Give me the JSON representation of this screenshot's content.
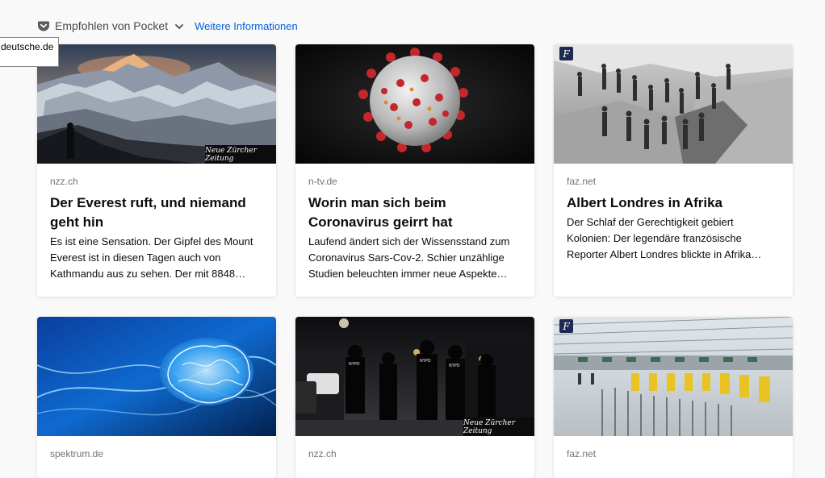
{
  "section": {
    "title": "Empfohlen von Pocket",
    "learn_more": "Weitere Informationen",
    "icon": "pocket-icon",
    "toggle_icon": "chevron-down-icon"
  },
  "tooltip": {
    "text": "deutsche.de"
  },
  "cards": [
    {
      "source": "nzz.ch",
      "title": "Der Everest ruft, und niemand geht hin",
      "excerpt": "Es ist eine Sensation. Der Gipfel des Mount Everest ist in diesen Tagen auch von Kathmandu aus zu sehen. Der mit 8848…",
      "image": "mountain-everest-image",
      "publisher_logo": "Neue Zürcher Zeitung"
    },
    {
      "source": "n-tv.de",
      "title": "Worin man sich beim Coronavirus geirrt hat",
      "excerpt": "Laufend ändert sich der Wissensstand zum Coronavirus Sars-Cov-2. Schier unzählige Studien beleuchten immer neue Aspekte…",
      "image": "coronavirus-image"
    },
    {
      "source": "faz.net",
      "title": "Albert Londres in Afrika",
      "excerpt": "Der Schlaf der Gerechtigkeit gebiert Kolonien: Der legendäre französische Reporter Albert Londres blickte in Afrika…",
      "image": "historical-workers-image",
      "publisher_logo": "F"
    },
    {
      "source": "spektrum.de",
      "image": "brain-image"
    },
    {
      "source": "nzz.ch",
      "image": "police-night-image",
      "publisher_logo": "Neue Zürcher Zeitung"
    },
    {
      "source": "faz.net",
      "image": "airport-terminal-image",
      "publisher_logo": "F"
    }
  ],
  "colors": {
    "background": "#f9f9fa",
    "link": "#0060df",
    "source_text": "#737373"
  }
}
